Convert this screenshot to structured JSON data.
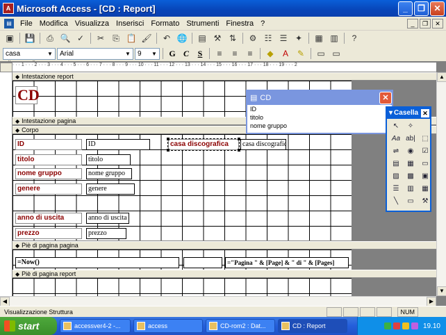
{
  "window": {
    "title": "Microsoft Access - [CD : Report]"
  },
  "menu": [
    "File",
    "Modifica",
    "Visualizza",
    "Inserisci",
    "Formato",
    "Strumenti",
    "Finestra",
    "?"
  ],
  "format_toolbar": {
    "object_combo": "casa discografic",
    "font_combo": "Arial",
    "size_combo": "9",
    "bold": "G",
    "italic": "C",
    "underline": "S"
  },
  "sections": {
    "report_header": "Intestazione report",
    "page_header": "Intestazione pagina",
    "detail": "Corpo",
    "page_footer": "Piè di pagina pagina",
    "report_footer": "Piè di pagina report"
  },
  "report_title": "CD",
  "detail_fields": [
    {
      "label": "ID",
      "field": "ID"
    },
    {
      "label": "titolo",
      "field": "titolo"
    },
    {
      "label": "nome gruppo",
      "field": "nome gruppo"
    },
    {
      "label": "genere",
      "field": "genere"
    },
    {
      "label": "anno di uscita",
      "field": "anno di uscita"
    },
    {
      "label": "prezzo",
      "field": "prezzo"
    },
    {
      "label": "casa discografica",
      "field": "casa discografic"
    }
  ],
  "page_footer_fields": {
    "date": "=Now()",
    "page": "=\"Pagina \" & [Page] & \" di \" & [Pages]"
  },
  "field_list": {
    "title": "CD",
    "items": [
      "ID",
      "titolo",
      "nome gruppo"
    ]
  },
  "toolbox": {
    "title": "Casella"
  },
  "status": {
    "text": "Visualizzazione Struttura",
    "num": "NUM"
  },
  "taskbar": {
    "start": "start",
    "tasks": [
      "accessver4-2 -...",
      "access",
      "CD-rom2 : Dat...",
      "CD : Report"
    ],
    "clock": "19.10"
  }
}
